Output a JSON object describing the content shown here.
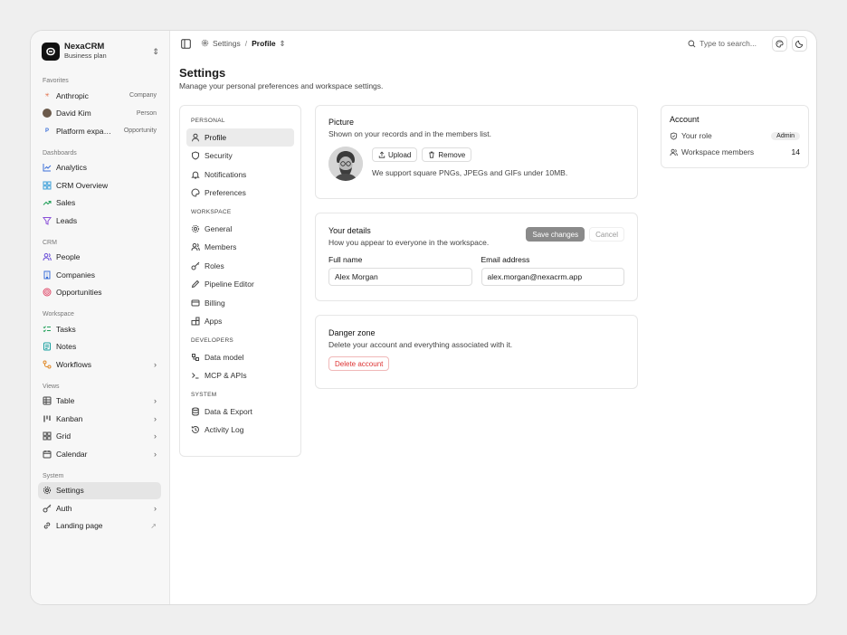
{
  "workspace": {
    "name": "NexaCRM",
    "plan": "Business plan"
  },
  "sidebar": {
    "favorites": {
      "title": "Favorites",
      "items": [
        {
          "label": "Anthropic",
          "meta": "Company"
        },
        {
          "label": "David Kim",
          "meta": "Person"
        },
        {
          "label": "Platform expa…",
          "meta": "Opportunity"
        }
      ]
    },
    "dashboards": {
      "title": "Dashboards",
      "items": [
        {
          "label": "Analytics"
        },
        {
          "label": "CRM Overview"
        },
        {
          "label": "Sales"
        },
        {
          "label": "Leads"
        }
      ]
    },
    "crm": {
      "title": "CRM",
      "items": [
        {
          "label": "People"
        },
        {
          "label": "Companies"
        },
        {
          "label": "Opportunities"
        }
      ]
    },
    "workspace": {
      "title": "Workspace",
      "items": [
        {
          "label": "Tasks"
        },
        {
          "label": "Notes"
        },
        {
          "label": "Workflows"
        }
      ]
    },
    "views": {
      "title": "Views",
      "items": [
        {
          "label": "Table"
        },
        {
          "label": "Kanban"
        },
        {
          "label": "Grid"
        },
        {
          "label": "Calendar"
        }
      ]
    },
    "system": {
      "title": "System",
      "items": [
        {
          "label": "Settings"
        },
        {
          "label": "Auth"
        },
        {
          "label": "Landing page"
        }
      ]
    }
  },
  "topbar": {
    "breadcrumb": {
      "parent": "Settings",
      "separator": "/",
      "current": "Profile"
    },
    "search_placeholder": "Type to search..."
  },
  "page": {
    "title": "Settings",
    "subtitle": "Manage your personal preferences and workspace settings."
  },
  "settings_nav": {
    "personal": {
      "title": "PERSONAL",
      "items": [
        "Profile",
        "Security",
        "Notifications",
        "Preferences"
      ]
    },
    "workspace": {
      "title": "WORKSPACE",
      "items": [
        "General",
        "Members",
        "Roles",
        "Pipeline Editor",
        "Billing",
        "Apps"
      ]
    },
    "developers": {
      "title": "DEVELOPERS",
      "items": [
        "Data model",
        "MCP & APIs"
      ]
    },
    "system": {
      "title": "SYSTEM",
      "items": [
        "Data & Export",
        "Activity Log"
      ]
    }
  },
  "picture": {
    "title": "Picture",
    "description": "Shown on your records and in the members list.",
    "upload_label": "Upload",
    "remove_label": "Remove",
    "hint": "We support square PNGs, JPEGs and GIFs under 10MB."
  },
  "details": {
    "title": "Your details",
    "description": "How you appear to everyone in the workspace.",
    "save_label": "Save changes",
    "cancel_label": "Cancel",
    "full_name_label": "Full name",
    "full_name_value": "Alex Morgan",
    "email_label": "Email address",
    "email_value": "alex.morgan@nexacrm.app"
  },
  "danger": {
    "title": "Danger zone",
    "description": "Delete your account and everything associated with it.",
    "delete_label": "Delete account"
  },
  "account": {
    "title": "Account",
    "role_label": "Your role",
    "role_value": "Admin",
    "members_label": "Workspace members",
    "members_value": "14"
  },
  "colors": {
    "danger": "#dd3333",
    "active_bg": "#e5e5e5",
    "accent_blue": "#3b6fd8"
  }
}
